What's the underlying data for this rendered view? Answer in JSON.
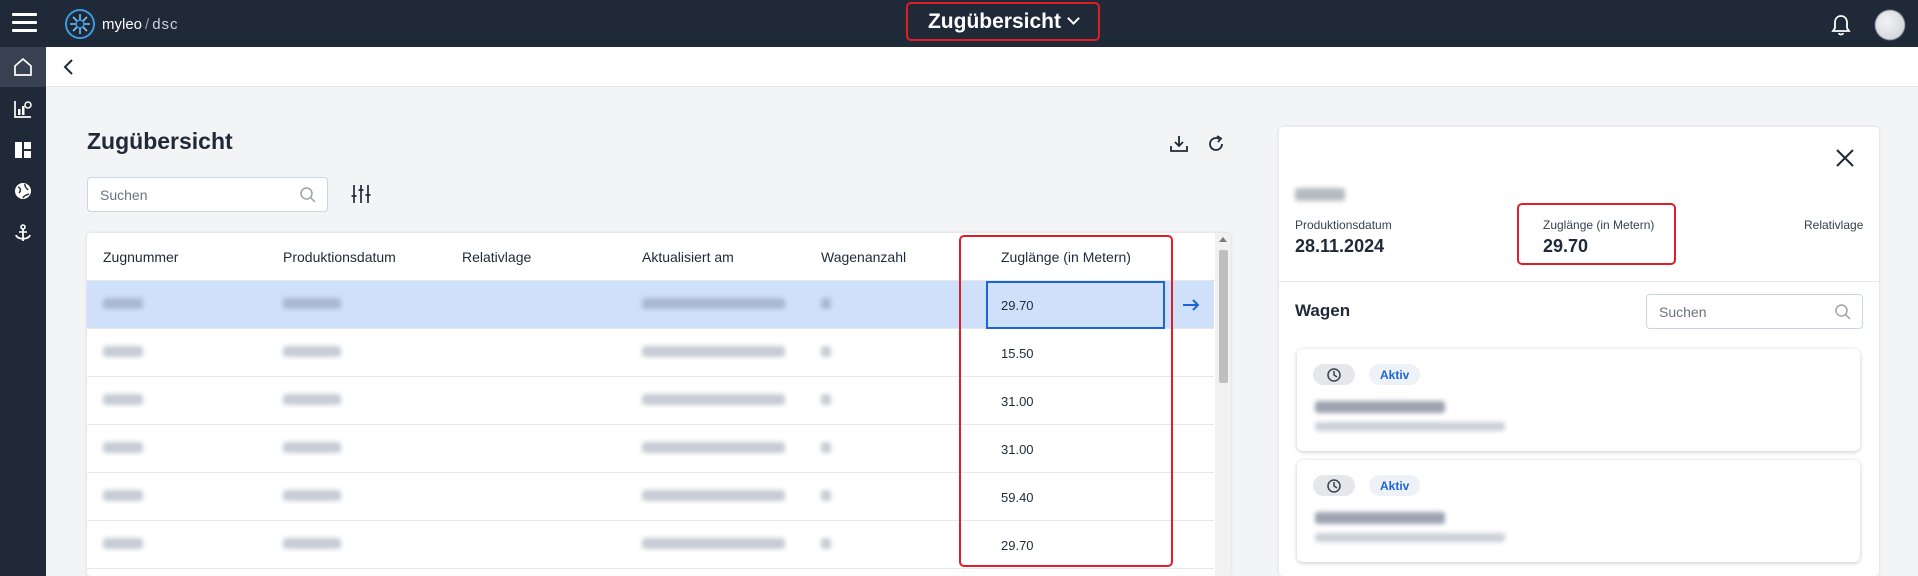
{
  "app": {
    "brand": "myleo",
    "brand_sub": "dsc",
    "nav_title": "Zugübersicht"
  },
  "page": {
    "title": "Zugübersicht",
    "search_placeholder": "Suchen"
  },
  "table": {
    "headers": [
      "Zugnummer",
      "Produktionsdatum",
      "Relativlage",
      "Aktualisiert am",
      "Wagenanzahl",
      "Zuglänge (in Metern)"
    ],
    "rows": [
      {
        "zuglaenge": "29.70",
        "selected": true
      },
      {
        "zuglaenge": "15.50",
        "selected": false
      },
      {
        "zuglaenge": "31.00",
        "selected": false
      },
      {
        "zuglaenge": "31.00",
        "selected": false
      },
      {
        "zuglaenge": "59.40",
        "selected": false
      },
      {
        "zuglaenge": "29.70",
        "selected": false
      }
    ]
  },
  "panel": {
    "produktionsdatum_label": "Produktionsdatum",
    "produktionsdatum_value": "28.11.2024",
    "zuglaenge_label": "Zuglänge (in Metern)",
    "zuglaenge_value": "29.70",
    "relativlage_label": "Relativlage",
    "wagen_title": "Wagen",
    "wagen_search_placeholder": "Suchen",
    "wagen": [
      {
        "status": "Aktiv"
      },
      {
        "status": "Aktiv"
      }
    ]
  },
  "colors": {
    "topbar": "#1f2937",
    "highlight": "#e11d2a",
    "accent": "#1d64d8",
    "selected_row": "#cfe0fb"
  },
  "icons": [
    "menu-icon",
    "logo-icon",
    "chevron-down-icon",
    "bell-icon",
    "home-icon",
    "chart-icon",
    "dashboard-icon",
    "globe-icon",
    "anchor-icon",
    "back-icon",
    "download-icon",
    "refresh-icon",
    "search-icon",
    "filter-icon",
    "arrow-right-icon",
    "close-icon",
    "clock-icon"
  ]
}
